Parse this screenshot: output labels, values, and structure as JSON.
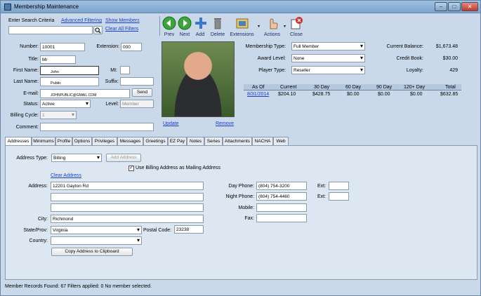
{
  "window": {
    "title": "Membership Maintenance",
    "controls": {
      "minimize": "–",
      "maximize": "□",
      "close": "✕"
    }
  },
  "search": {
    "label": "Enter Search Criteria",
    "value": "",
    "advanced_filtering": "Advanced Filtering",
    "show_members": "Show Members",
    "clear_all_filters": "Clear All Filters",
    "search_icon": "magnifier-icon"
  },
  "toolbar": {
    "prev": "Prev",
    "next": "Next",
    "add": "Add",
    "delete": "Delete",
    "extensions": "Extensions",
    "actions": "Actions",
    "close": "Close"
  },
  "member": {
    "number_label": "Number:",
    "number": "10001",
    "extension_label": "Extension:",
    "extension": "000",
    "title_label": "Title:",
    "title": "Mr",
    "first_name_label": "First Name:",
    "first_name": "John",
    "mi_label": "MI:",
    "mi": "",
    "last_name_label": "Last Name:",
    "last_name": "Public",
    "suffix_label": "Suffix:",
    "suffix": "",
    "email_label": "E-mail:",
    "email": "JOHNPUBLIC@GMAIL.COM",
    "send_label": "Send",
    "status_label": "Status:",
    "status": "Active",
    "level_label": "Level:",
    "level": "Member",
    "billing_cycle_label": "Billing Cycle:",
    "billing_cycle": "1",
    "comment_label": "Comment:",
    "comment": ""
  },
  "photo": {
    "update": "Update",
    "remove": "Remove"
  },
  "membership": {
    "type_label": "Membership Type:",
    "type": "Full Member",
    "award_label": "Award Level:",
    "award": "None",
    "player_label": "Player Type:",
    "player": "Reseller",
    "current_balance_label": "Current Balance:",
    "current_balance": "$1,673.48",
    "credit_book_label": "Credit Book:",
    "credit_book": "$30.00",
    "loyalty_label": "Loyalty:",
    "loyalty": "429"
  },
  "aging": {
    "headers": [
      "As Of",
      "Current",
      "30 Day",
      "60 Day",
      "90 Day",
      "120+ Day",
      "Total"
    ],
    "row": [
      "8/31/2014",
      "$204.10",
      "$428.75",
      "$0.00",
      "$0.00",
      "$0.00",
      "$632.85"
    ]
  },
  "tabs": [
    "Addresses",
    "Minimums",
    "Profile",
    "Options",
    "Privileges",
    "Messages",
    "Greetings",
    "EZ Pay",
    "Notes",
    "Series",
    "Attachments",
    "NACHA",
    "Web"
  ],
  "address": {
    "type_label": "Address Type:",
    "type": "Billing",
    "add_address": "Add Address",
    "use_billing": "Use Billing Address as Mailing Address",
    "use_billing_checked": "✓",
    "clear_address": "Clear Address",
    "address_label": "Address:",
    "line1": "12201 Gayton Rd",
    "line2": "",
    "line3": "",
    "city_label": "City:",
    "city": "Richmond",
    "state_label": "State/Prov:",
    "state": "Virginia",
    "postal_label": "Postal Code:",
    "postal": "23238",
    "country_label": "Country:",
    "country": "",
    "copy_button": "Copy Address to Clipboard",
    "day_phone_label": "Day Phone:",
    "day_phone": "(804) 754-3200",
    "night_phone_label": "Night Phone:",
    "night_phone": "(804) 754-4460",
    "ext_label": "Ext:",
    "day_ext": "",
    "night_ext": "",
    "mobile_label": "Mobile:",
    "mobile": "",
    "fax_label": "Fax:",
    "fax": ""
  },
  "status_bar": "Member Records Found: 67  Filters applied: 0  No member selected.",
  "colors": {
    "accent": "#1a3ecf",
    "window_bg": "#c9d9ea",
    "titlebar": "#9fc0e0",
    "close_button": "#c0392b"
  }
}
